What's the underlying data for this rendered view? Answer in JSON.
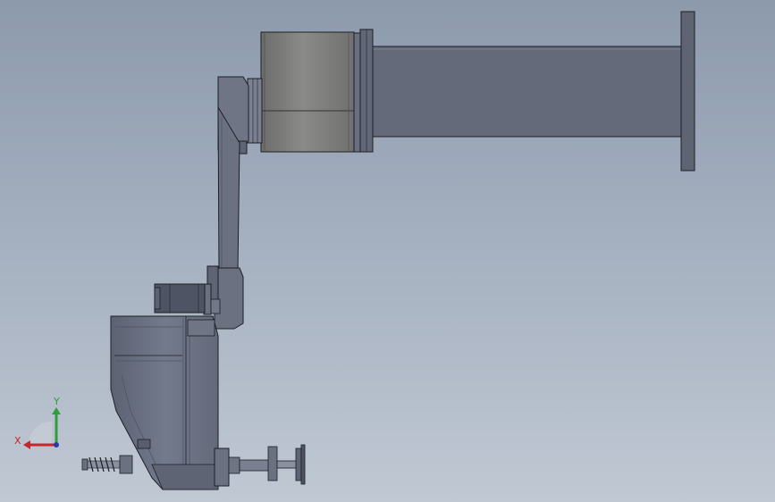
{
  "viewport": {
    "background_top": "#8d9aac",
    "background_bottom": "#c0c8d3"
  },
  "model": {
    "part_color": "#6b7181",
    "part_dark": "#4e5464",
    "motor_color": "#7f7f7d",
    "outline_color": "#1c1f26"
  },
  "triad": {
    "x_label": "X",
    "y_label": "Y",
    "x_color": "#c0282d",
    "y_color": "#2f9e3a",
    "z_color": "#2b3aa8"
  }
}
